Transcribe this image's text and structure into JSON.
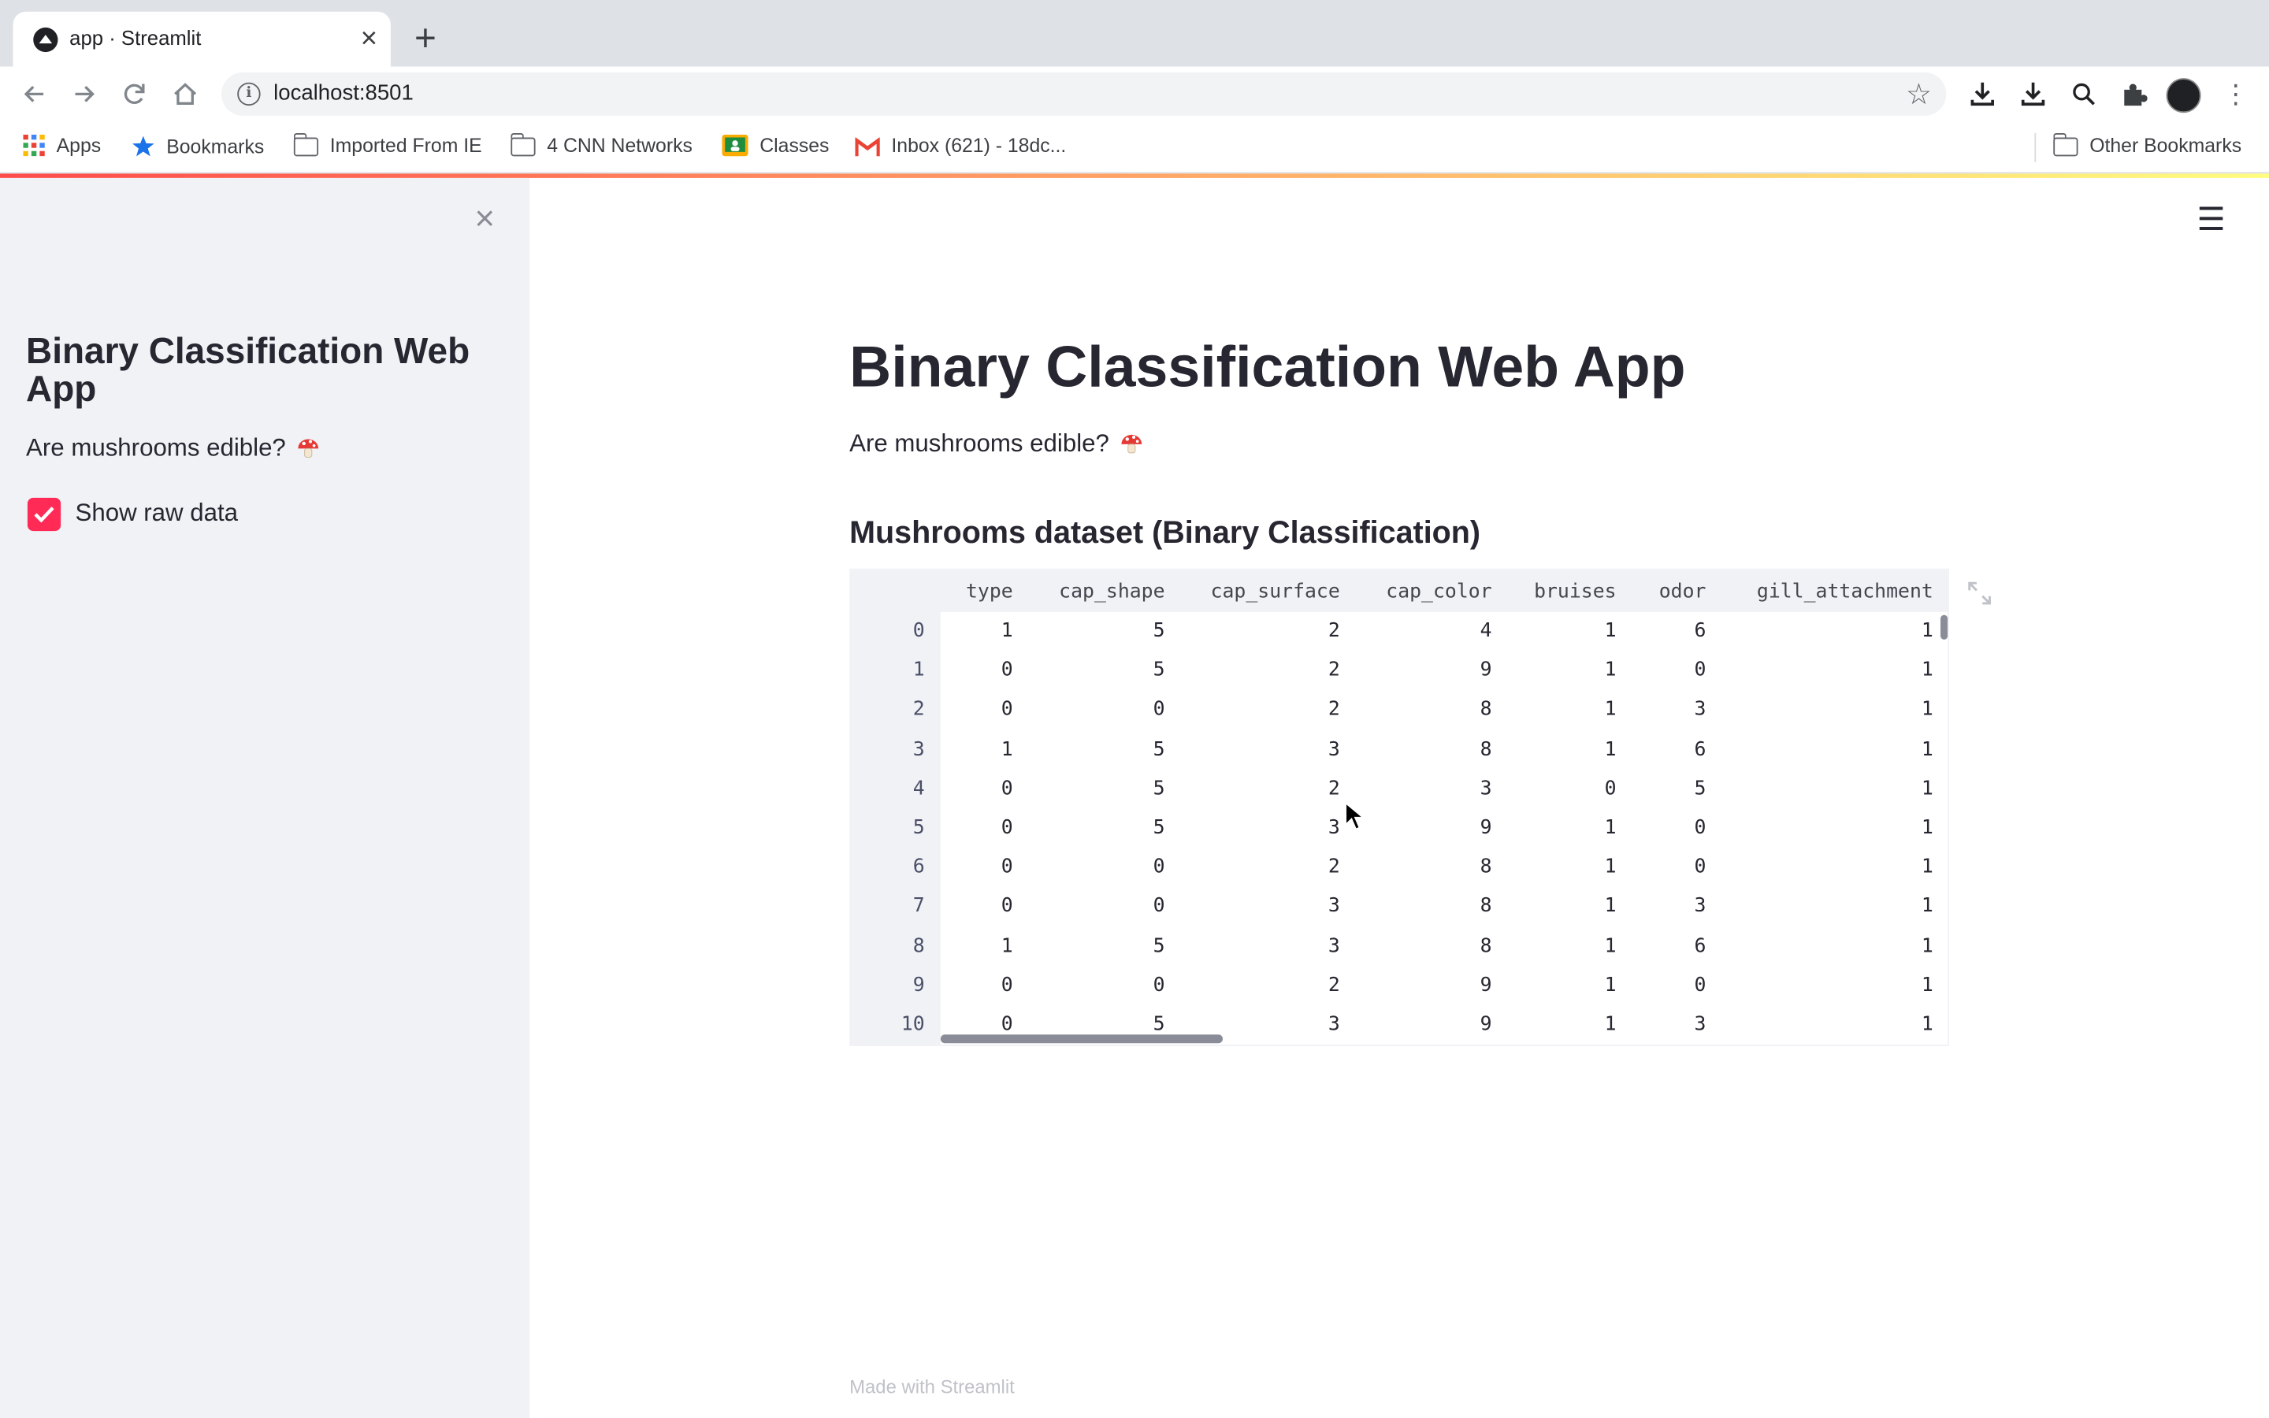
{
  "browser": {
    "tab_title": "app · Streamlit",
    "tab_close": "×",
    "new_tab": "+",
    "url": "localhost:8501",
    "bookmarks": [
      {
        "label": "Apps",
        "icon": "apps-grid-icon"
      },
      {
        "label": "Bookmarks",
        "icon": "star-icon"
      },
      {
        "label": "Imported From IE",
        "icon": "folder-icon"
      },
      {
        "label": "4 CNN Networks",
        "icon": "folder-icon"
      },
      {
        "label": "Classes",
        "icon": "google-classroom-icon"
      },
      {
        "label": "Inbox (621) - 18dc...",
        "icon": "gmail-icon"
      }
    ],
    "other_bookmarks": "Other Bookmarks"
  },
  "sidebar": {
    "close_icon": "×",
    "title": "Binary Classification Web App",
    "subtitle": "Are mushrooms edible?",
    "checkbox_label": "Show raw data",
    "checkbox_checked": true,
    "accent_color": "#ff2b56"
  },
  "main": {
    "title": "Binary Classification Web App",
    "subtitle": "Are mushrooms edible?",
    "dataset_header": "Mushrooms dataset (Binary Classification)",
    "footer": "Made with Streamlit"
  },
  "table": {
    "columns": [
      "type",
      "cap_shape",
      "cap_surface",
      "cap_color",
      "bruises",
      "odor",
      "gill_attachment"
    ],
    "index": [
      "0",
      "1",
      "2",
      "3",
      "4",
      "5",
      "6",
      "7",
      "8",
      "9",
      "10"
    ],
    "rows": [
      [
        "1",
        "5",
        "2",
        "4",
        "1",
        "6",
        "1"
      ],
      [
        "0",
        "5",
        "2",
        "9",
        "1",
        "0",
        "1"
      ],
      [
        "0",
        "0",
        "2",
        "8",
        "1",
        "3",
        "1"
      ],
      [
        "1",
        "5",
        "3",
        "8",
        "1",
        "6",
        "1"
      ],
      [
        "0",
        "5",
        "2",
        "3",
        "0",
        "5",
        "1"
      ],
      [
        "0",
        "5",
        "3",
        "9",
        "1",
        "0",
        "1"
      ],
      [
        "0",
        "0",
        "2",
        "8",
        "1",
        "0",
        "1"
      ],
      [
        "0",
        "0",
        "3",
        "8",
        "1",
        "3",
        "1"
      ],
      [
        "1",
        "5",
        "3",
        "8",
        "1",
        "6",
        "1"
      ],
      [
        "0",
        "0",
        "2",
        "9",
        "1",
        "0",
        "1"
      ],
      [
        "0",
        "5",
        "3",
        "9",
        "1",
        "3",
        "1"
      ]
    ]
  }
}
